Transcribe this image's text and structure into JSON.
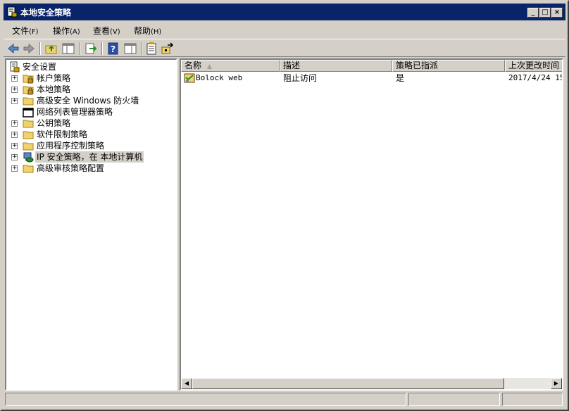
{
  "window": {
    "title": "本地安全策略"
  },
  "menu": [
    {
      "label": "文件",
      "accel": "(F)"
    },
    {
      "label": "操作",
      "accel": "(A)"
    },
    {
      "label": "查看",
      "accel": "(V)"
    },
    {
      "label": "帮助",
      "accel": "(H)"
    }
  ],
  "tree": {
    "root": "安全设置",
    "items": [
      {
        "label": "帐户策略",
        "icon": "folder-lock-icon",
        "expandable": true
      },
      {
        "label": "本地策略",
        "icon": "folder-lock-icon",
        "expandable": true
      },
      {
        "label": "高级安全 Windows 防火墙",
        "icon": "folder-icon",
        "expandable": true
      },
      {
        "label": "网络列表管理器策略",
        "icon": "folder-icon",
        "expandable": false
      },
      {
        "label": "公钥策略",
        "icon": "folder-icon",
        "expandable": true
      },
      {
        "label": "软件限制策略",
        "icon": "folder-icon",
        "expandable": true
      },
      {
        "label": "应用程序控制策略",
        "icon": "folder-icon",
        "expandable": true
      },
      {
        "label": "IP 安全策略，在 本地计算机",
        "icon": "ip-security-icon",
        "expandable": true,
        "selected": true
      },
      {
        "label": "高级审核策略配置",
        "icon": "folder-icon",
        "expandable": true
      }
    ]
  },
  "list": {
    "columns": [
      "名称",
      "描述",
      "策略已指派",
      "上次更改时间"
    ],
    "rows": [
      {
        "name": "Bolock web",
        "description": "阻止访问",
        "assigned": "是",
        "modified": "2017/4/24 15:"
      }
    ]
  },
  "colors": {
    "titlebar": "#0a246a",
    "face": "#d4d0c8",
    "desktop": "#3a6ea5"
  }
}
